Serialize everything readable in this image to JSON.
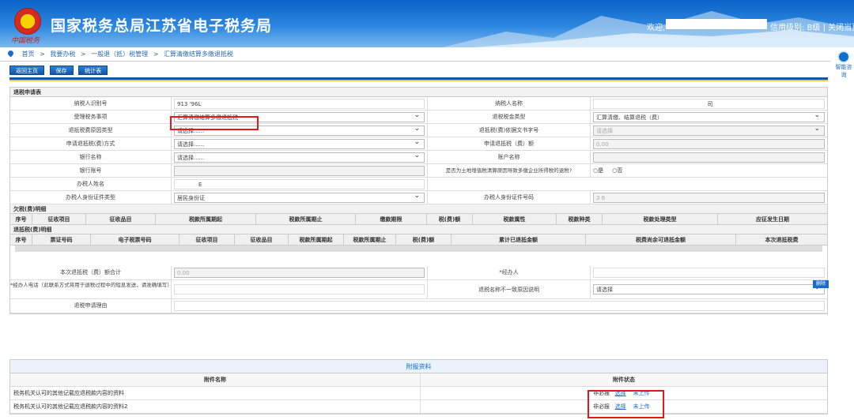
{
  "header": {
    "title": "国家税务总局江苏省电子税务局",
    "logo_signature": "中国税务",
    "welcome": "欢迎,",
    "user_tail": "信用级别: B级 | 关闭当页"
  },
  "breadcrumb": [
    "首页",
    ">",
    "我要办税",
    ">",
    "一般退（抵）税管理",
    ">",
    "汇算清缴结算多缴退抵税"
  ],
  "assistant": {
    "label": "智能咨询"
  },
  "toolbar": {
    "back": "返回主页",
    "save": "保存",
    "stats": "统计表"
  },
  "form": {
    "section_title": "退税申请表",
    "rows": [
      {
        "l": "纳税人识别号",
        "v": "913            '96L",
        "l2": "纳税人名称",
        "v2": "司"
      },
      {
        "l": "受理税务事项",
        "v": "汇算清缴结算多缴退抵税",
        "l2": "退税税金类型",
        "v2": "汇算清缴、结算退税（费）"
      },
      {
        "l": "退抵税费原因类型",
        "v": "请选择......",
        "l2": "退抵税(费)依据文书字号",
        "v2": "请选择"
      },
      {
        "l": "申请退抵税(费)方式",
        "v": "请选择......",
        "l2": "申请退抵税（费）额",
        "v2": "0.00"
      },
      {
        "l": "银行名称",
        "v": "请选择......",
        "l2": "账户名称",
        "v2": ""
      },
      {
        "l": "银行账号",
        "v": "",
        "l2": "是否为土地增值税清算原因导致多缴企业所得税的退税?",
        "v2": ""
      },
      {
        "l": "办税人姓名",
        "v": "E",
        "l2": "",
        "v2": ""
      },
      {
        "l": "办税人身份证件类型",
        "v": "居民身份证",
        "l2": "办税人身份证件号码",
        "v2": "3                     6"
      }
    ],
    "radio_yes": "是",
    "radio_no": "否"
  },
  "arrears": {
    "title": "欠税(费)明细",
    "columns": [
      "序号",
      "征收项目",
      "征收品目",
      "税款所属期起",
      "税款所属期止",
      "缴款期限",
      "税(费)额",
      "税款属性",
      "税款种类",
      "税款处理类型",
      "应征发生日期"
    ]
  },
  "refund": {
    "title": "退抵税(费)明细",
    "columns": [
      "序号",
      "票证号码",
      "电子税票号码",
      "征收项目",
      "征收品目",
      "税款所属期起",
      "税款所属期止",
      "税(费)额",
      "累计已退抵金额",
      "税费尚余可退抵金额",
      "本次退抵税费"
    ],
    "delete": "删除"
  },
  "summary": {
    "total_label": "本次退抵税（费）额合计",
    "total_value": "0.00",
    "agent_label": "*经办人",
    "phone_label": "*经办人电话（此联系方式将用于退税过程中的短息发送，请准确填写）",
    "reason_label": "退税名称不一致原因说明",
    "reason_value": "请选择",
    "apply_reason_label": "退税申请理由"
  },
  "attachments": {
    "title": "附报资料",
    "col_name": "附件名称",
    "col_status": "附件状态",
    "items": [
      {
        "name": "税务机关认可的其他记载应退税款内容的资料",
        "required": "非必报",
        "choose": "选择",
        "status": "未上传"
      },
      {
        "name": "税务机关认可的其他记载应退税款内容的资料2",
        "required": "非必报",
        "choose": "选择",
        "status": "未上传"
      }
    ]
  }
}
